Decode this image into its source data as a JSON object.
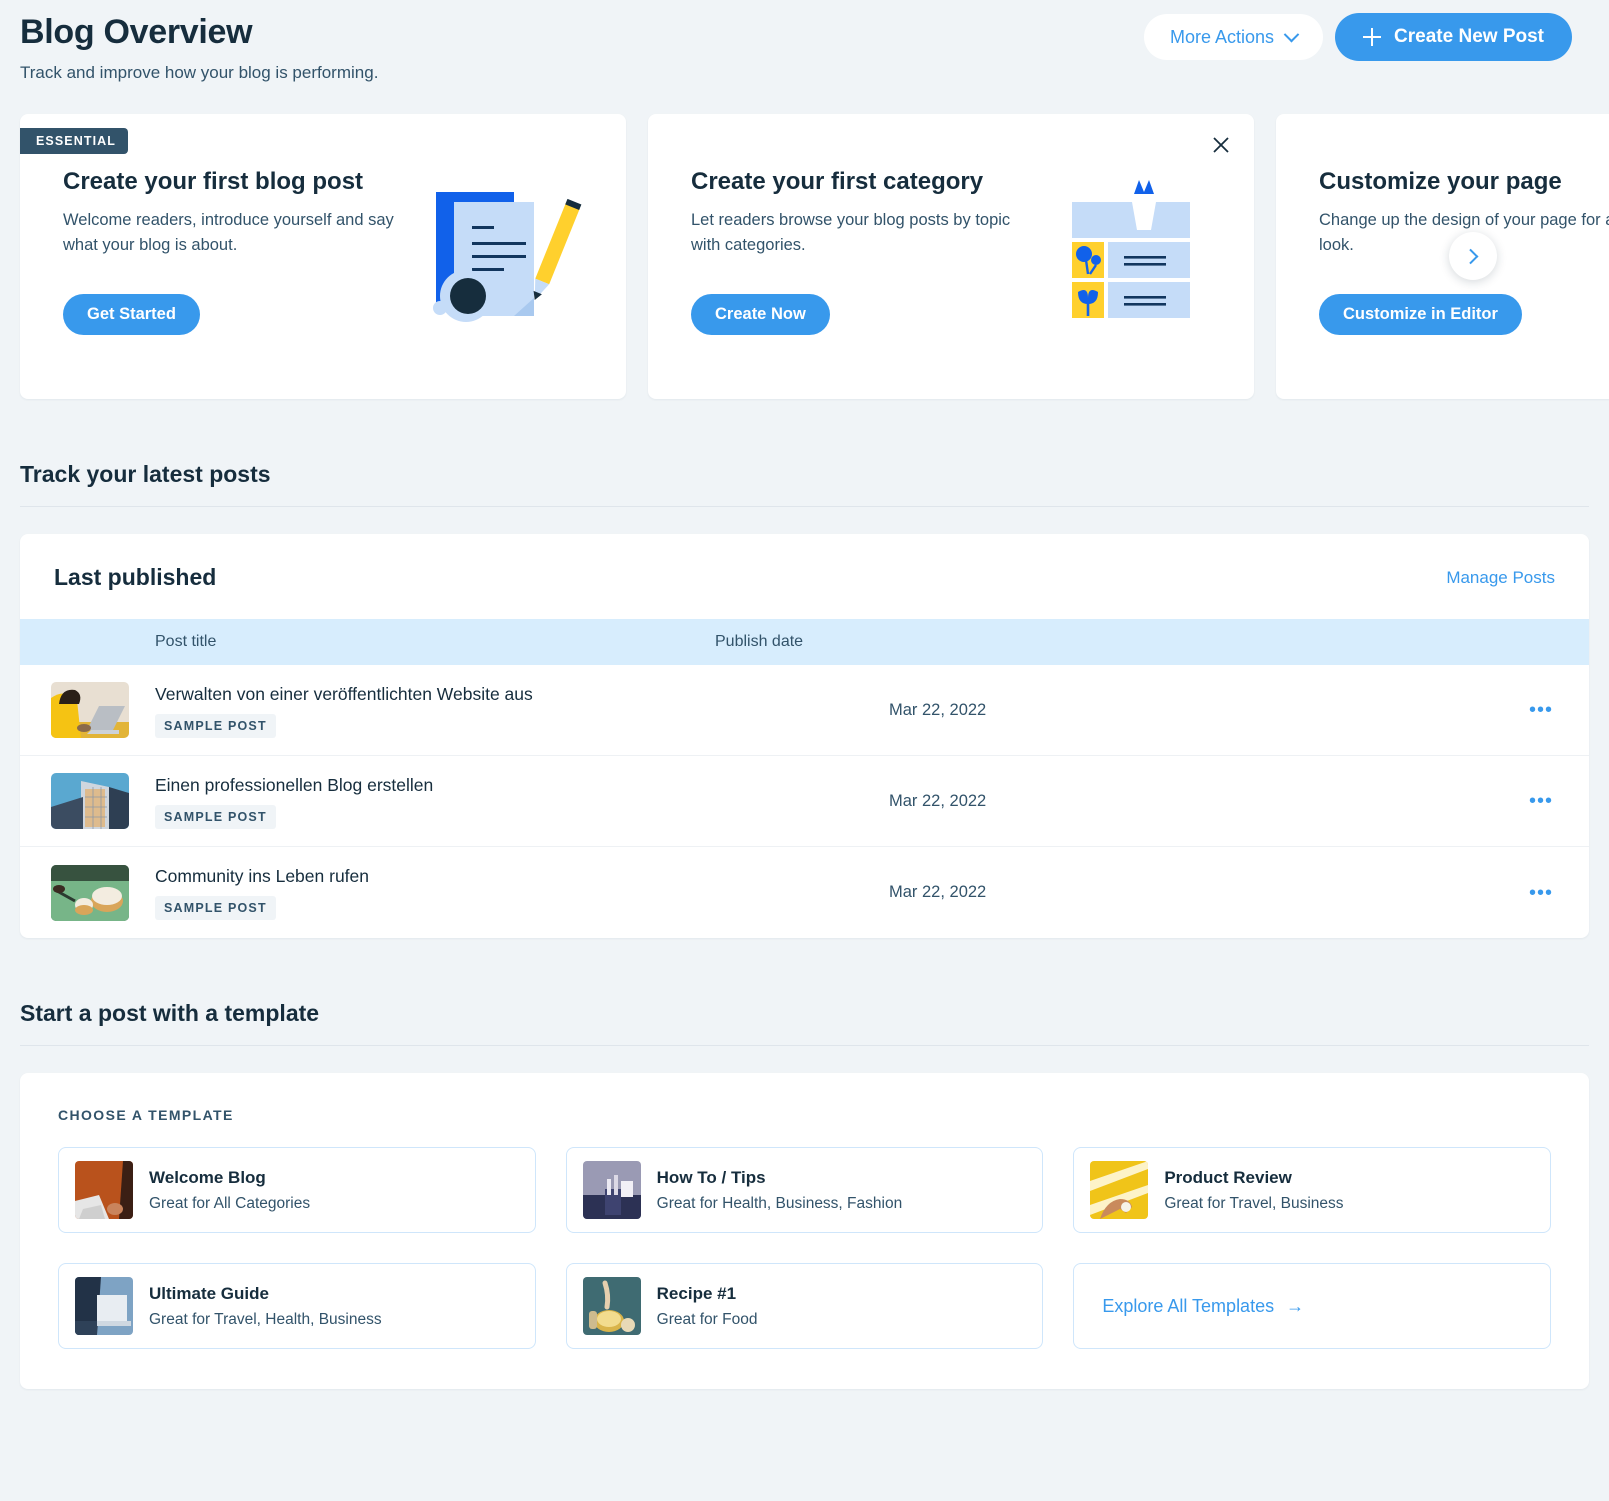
{
  "header": {
    "title": "Blog Overview",
    "subtitle": "Track and improve how your blog is performing.",
    "more_actions_label": "More Actions",
    "create_post_label": "Create New Post"
  },
  "promos": [
    {
      "badge": "ESSENTIAL",
      "title": "Create your first blog post",
      "desc": "Welcome readers, introduce yourself and say what your blog is about.",
      "cta": "Get Started"
    },
    {
      "badge": "",
      "title": "Create your first category",
      "desc": "Let readers browse your blog posts by topic with categories.",
      "cta": "Create Now"
    },
    {
      "badge": "",
      "title": "Customize your page",
      "desc": "Change up the design of your page for a fresh look.",
      "cta": "Customize in Editor"
    }
  ],
  "posts_section": {
    "section_title": "Track your latest posts",
    "panel_title": "Last published",
    "manage_link": "Manage Posts",
    "columns": {
      "title": "Post title",
      "date": "Publish date"
    },
    "rows": [
      {
        "title": "Verwalten von einer veröffentlichten Website aus",
        "tag": "SAMPLE POST",
        "date": "Mar 22, 2022",
        "menu": "•••"
      },
      {
        "title": "Einen professionellen Blog erstellen",
        "tag": "SAMPLE POST",
        "date": "Mar 22, 2022",
        "menu": "•••"
      },
      {
        "title": "Community ins Leben rufen",
        "tag": "SAMPLE POST",
        "date": "Mar 22, 2022",
        "menu": "•••"
      }
    ]
  },
  "templates_section": {
    "section_title": "Start a post with a template",
    "eyebrow": "CHOOSE A TEMPLATE",
    "items": [
      {
        "name": "Welcome Blog",
        "sub": "Great for All Categories"
      },
      {
        "name": "How To / Tips",
        "sub": "Great for Health, Business, Fashion"
      },
      {
        "name": "Product Review",
        "sub": "Great for Travel, Business"
      },
      {
        "name": "Ultimate Guide",
        "sub": "Great for Travel, Health, Business"
      },
      {
        "name": "Recipe #1",
        "sub": "Great for Food"
      }
    ],
    "explore_label": "Explore All Templates",
    "explore_arrow": "→"
  },
  "colors": {
    "accent": "#3899ec",
    "dark": "#162d3d",
    "muted": "#32536a",
    "page_bg": "#f0f4f7",
    "table_head_bg": "#d7edfd"
  }
}
